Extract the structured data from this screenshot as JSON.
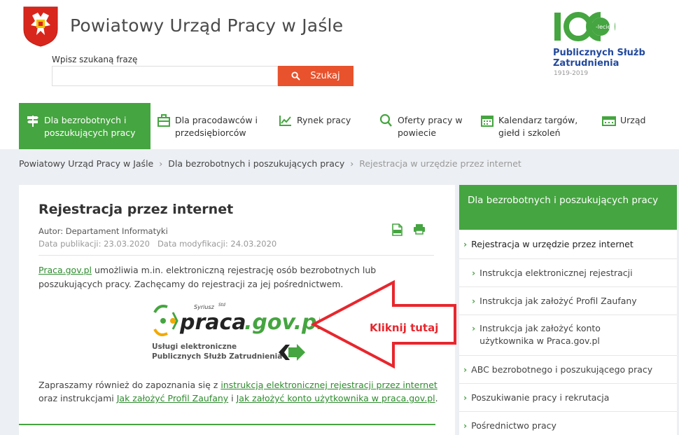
{
  "header": {
    "site_title": "Powiatowy Urząd Pracy w Jaśle",
    "search_label": "Wpisz szukaną frazę",
    "search_placeholder": "",
    "search_button": "Szukaj",
    "logo100": {
      "lecie": "-lecie",
      "line1": "Publicznych Służb",
      "line2": "Zatrudnienia",
      "years": "1919-2019"
    }
  },
  "nav": {
    "items": [
      {
        "label": "Dla bezrobotnych i poszukujących pracy",
        "icon": "signpost-icon"
      },
      {
        "label": "Dla pracodawców i przedsiębiorców",
        "icon": "briefcase-icon"
      },
      {
        "label": "Rynek pracy",
        "icon": "chart-icon"
      },
      {
        "label": "Oferty pracy w powiecie",
        "icon": "search-icon"
      },
      {
        "label": "Kalendarz targów, giełd i szkoleń",
        "icon": "calendar-icon"
      },
      {
        "label": "Urząd",
        "icon": "office-icon"
      }
    ]
  },
  "breadcrumb": {
    "items": [
      "Powiatowy Urząd Pracy w Jaśle",
      "Dla bezrobotnych i poszukujących pracy",
      "Rejestracja w urzędzie przez internet"
    ],
    "separator": "›"
  },
  "article": {
    "title": "Rejestracja przez internet",
    "author": "Autor: Departament Informatyki",
    "dates": "Data publikacji: 23.03.2020   Data modyfikacji: 24.03.2020",
    "intro_link": "Praca.gov.pl",
    "intro_text": " umożliwia m.in. elektroniczną rejestrację osób bezrobotnych lub poszukujących pracy. Zachęcamy do rejestracji za jej pośrednictwem.",
    "logo_syriusz": "Syriusz",
    "logo_std": "Std",
    "logo_praca": "praca",
    "logo_gov": ".gov.pl",
    "uslugi_line1": "Usługi elektroniczne",
    "uslugi_line2": "Publicznych Służb Zatrudnienia",
    "outro_pre": "Zapraszamy również do zapoznania się z ",
    "outro_link1": "instrukcją elektronicznej rejestracji przez internet",
    "outro_mid1": " oraz instrukcjami ",
    "outro_link2": "Jak założyć Profil Zaufany",
    "outro_mid2": " i ",
    "outro_link3": "Jak założyć konto użytkownika w praca.gov.pl",
    "outro_end": ".",
    "annotation": "Kliknij tutaj"
  },
  "sidebar": {
    "heading": "Dla bezrobotnych i poszukujących pracy",
    "items": [
      {
        "label": "Rejestracja w urzędzie przez internet",
        "level": "top",
        "current": true
      },
      {
        "label": "Instrukcja elektronicznej rejestracji",
        "level": "sub"
      },
      {
        "label": "Instrukcja jak założyć Profil Zaufany",
        "level": "sub"
      },
      {
        "label": "Instrukcja jak założyć konto użytkownika w Praca.gov.pl",
        "level": "sub"
      },
      {
        "label": "ABC bezrobotnego i poszukującego pracy",
        "level": "top"
      },
      {
        "label": "Poszukiwanie pracy i rekrutacja",
        "level": "top"
      },
      {
        "label": "Pośrednictwo pracy",
        "level": "top"
      }
    ]
  },
  "colors": {
    "accent_green": "#45a540",
    "search_orange": "#e8522c",
    "annotation_red": "#e8262d",
    "logo_blue": "#234a9e"
  }
}
